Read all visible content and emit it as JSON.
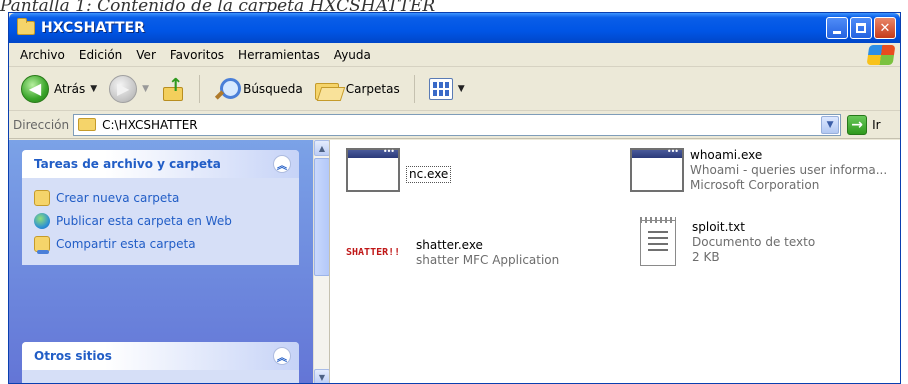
{
  "caption": "Pantalla 1: Contenido de la carpeta HXCSHATTER",
  "window": {
    "title": "HXCSHATTER",
    "minimize_label": "",
    "maximize_label": "",
    "close_label": "✕"
  },
  "menu": [
    "Archivo",
    "Edición",
    "Ver",
    "Favoritos",
    "Herramientas",
    "Ayuda"
  ],
  "toolbar": {
    "back_label": "Atrás",
    "search_label": "Búsqueda",
    "folders_label": "Carpetas"
  },
  "address": {
    "label": "Dirección",
    "value": "C:\\HXCSHATTER",
    "go_label": "Ir"
  },
  "taskpane": {
    "file_tasks": {
      "title": "Tareas de archivo y carpeta",
      "items": [
        "Crear nueva carpeta",
        "Publicar esta carpeta en Web",
        "Compartir esta carpeta"
      ]
    },
    "other_places": {
      "title": "Otros sitios"
    }
  },
  "files": [
    {
      "name": "nc.exe",
      "line1": "",
      "line2": "",
      "icon": "application-icon"
    },
    {
      "name": "whoami.exe",
      "line1": "Whoami - queries user informa...",
      "line2": "Microsoft Corporation",
      "icon": "application-icon"
    },
    {
      "name": "shatter.exe",
      "line1": "shatter MFC Application",
      "line2": "",
      "icon": "shatter-logo-icon",
      "logo_text": "SHATTER!!"
    },
    {
      "name": "sploit.txt",
      "line1": "Documento de texto",
      "line2": "2 KB",
      "icon": "text-document-icon"
    }
  ]
}
